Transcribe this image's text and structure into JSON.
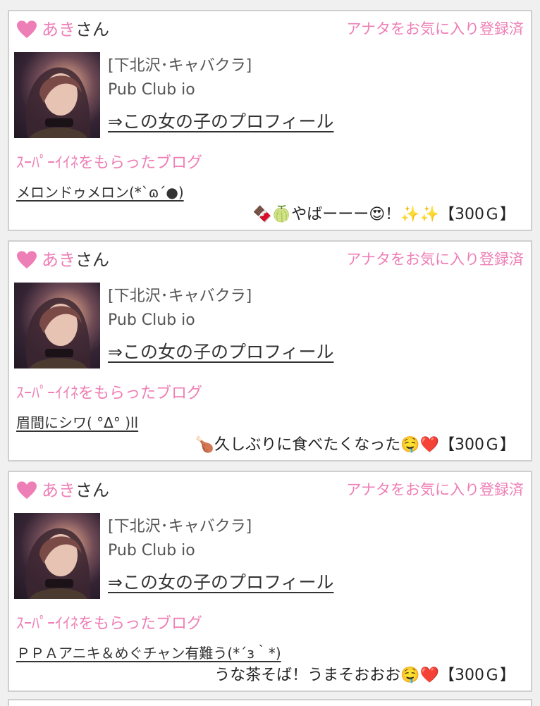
{
  "colors": {
    "accent_pink": "#ee7fb6",
    "text": "#333333",
    "card_border": "#cfcfcf",
    "background": "#f0f0f0"
  },
  "cards": [
    {
      "heart_icon": "heart-icon",
      "girl_name": "あき",
      "name_suffix": "さん",
      "favorite_status": "アナタをお気に入り登録済",
      "area": "[下北沢･キャバクラ]",
      "shop": "Pub Club io",
      "profile_link": "⇒この女の子のプロフィール",
      "section_label": "ｽｰﾊﾟｰｲｲﾈをもらったブログ",
      "blog_title": "メロンドゥメロン(*`ɷ´●)",
      "blog_comment": "🍫🍈やばーーー😍！✨✨",
      "points": "【300Ｇ】"
    },
    {
      "heart_icon": "heart-icon",
      "girl_name": "あき",
      "name_suffix": "さん",
      "favorite_status": "アナタをお気に入り登録済",
      "area": "[下北沢･キャバクラ]",
      "shop": "Pub Club io",
      "profile_link": "⇒この女の子のプロフィール",
      "section_label": "ｽｰﾊﾟｰｲｲﾈをもらったブログ",
      "blog_title": "眉間にシワ( °Δ° )ll",
      "blog_comment": "🍗久しぶりに食べたくなった🤤❤️",
      "points": "【300Ｇ】"
    },
    {
      "heart_icon": "heart-icon",
      "girl_name": "あき",
      "name_suffix": "さん",
      "favorite_status": "アナタをお気に入り登録済",
      "area": "[下北沢･キャバクラ]",
      "shop": "Pub Club io",
      "profile_link": "⇒この女の子のプロフィール",
      "section_label": "ｽｰﾊﾟｰｲｲﾈをもらったブログ",
      "blog_title": "ＰＰＡアニキ＆めぐチャン有難う(*´з｀*)",
      "blog_comment": "うな茶そば！うまそおおお🤤❤️",
      "points": "【300Ｇ】"
    }
  ]
}
